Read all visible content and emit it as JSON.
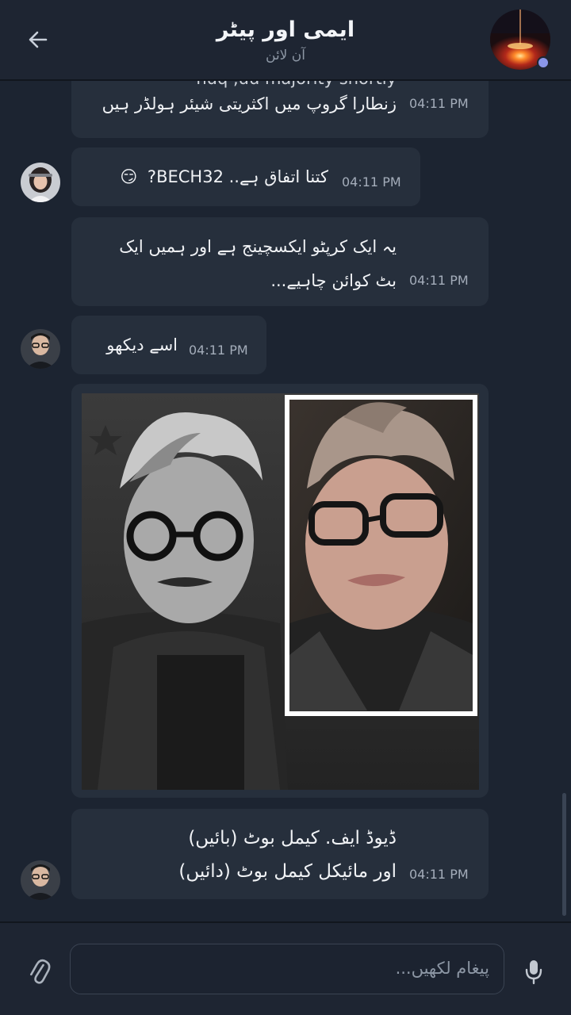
{
  "header": {
    "title": "ایمی اور پیٹر",
    "status": "آن لائن"
  },
  "messages": [
    {
      "partial_line": "huq ,uu majority shortly",
      "line": "زنطارا گروپ میں اکثریتی شیئر ہولڈر ہیں",
      "time": "04:11 PM"
    },
    {
      "text": "کتنا اتفاق ہے.. BECH32?",
      "emoji": "😏",
      "time": "04:11 PM"
    },
    {
      "line1": "یہ ایک کرپٹو ایکسچینج ہے اور ہمیں ایک",
      "line2": "بٹ کوائن چاہیے...",
      "time": "04:11 PM"
    },
    {
      "text": "اسے دیکھو",
      "time": "04:11 PM"
    },
    {
      "line1": "ڈیوڈ ایف. کیمل بوٹ (بائیں)",
      "line2": "اور مائیکل کیمل بوٹ (دائیں)",
      "time": "04:11 PM"
    }
  ],
  "input": {
    "placeholder": "پیغام لکھیں..."
  },
  "colors": {
    "background": "#1c2431",
    "bubble": "#262f3c",
    "accent": "#8a96e8"
  }
}
